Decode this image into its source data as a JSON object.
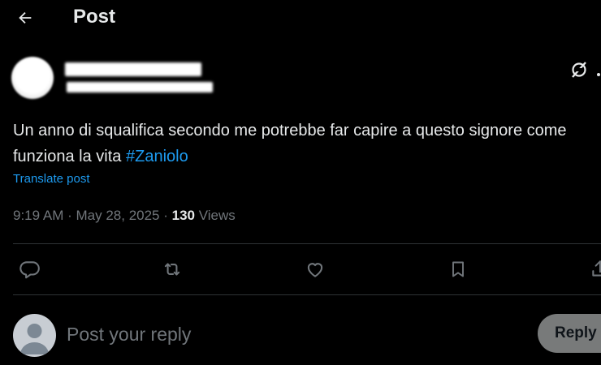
{
  "header": {
    "title": "Post",
    "back_icon": "arrow-left-icon"
  },
  "post": {
    "text_before": "Un anno di squalifica secondo me potrebbe far capire a questo signore come funziona la vita",
    "hashtag": "#Zaniolo",
    "translate_label": "Translate post",
    "time": "9:19 AM",
    "date": "May 28, 2025",
    "views_count": "130",
    "views_label": "Views"
  },
  "actions": [
    {
      "name": "reply-icon"
    },
    {
      "name": "repost-icon"
    },
    {
      "name": "like-icon"
    },
    {
      "name": "bookmark-icon"
    },
    {
      "name": "share-icon"
    }
  ],
  "composer": {
    "placeholder": "Post your reply",
    "button_label": "Reply"
  },
  "colors": {
    "background": "#000000",
    "text": "#e7e9ea",
    "muted": "#71767b",
    "accent": "#1d9bf0",
    "divider": "#2f3336",
    "reply_button": "#787a7a"
  }
}
